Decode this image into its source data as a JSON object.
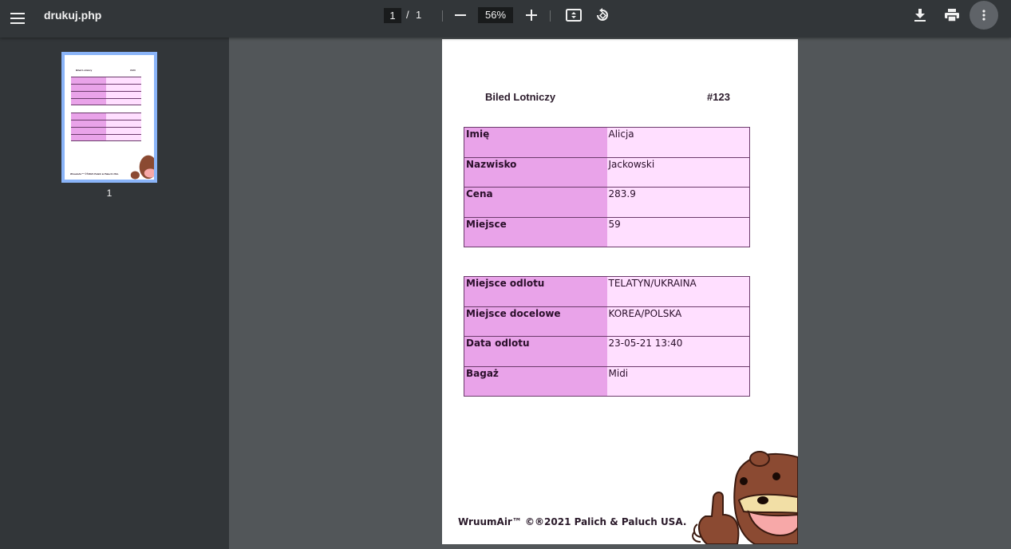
{
  "toolbar": {
    "doc_title": "drukuj.php",
    "current_page": "1",
    "page_sep": "/",
    "total_pages": "1",
    "zoom": "56%"
  },
  "sidebar": {
    "thumbnail_label": "1"
  },
  "ticket": {
    "title": "Biled Lotniczy",
    "number": "#123",
    "passenger_rows": [
      {
        "label": "Imię",
        "value": "Alicja"
      },
      {
        "label": "Nazwisko",
        "value": "Jackowski"
      },
      {
        "label": "Cena",
        "value": "283.9"
      },
      {
        "label": "Miejsce",
        "value": "59"
      }
    ],
    "flight_rows": [
      {
        "label": "Miejsce odlotu",
        "value": "TELATYN/UKRAINA"
      },
      {
        "label": "Miejsce docelowe",
        "value": "KOREA/POLSKA"
      },
      {
        "label": "Data odlotu",
        "value": "23-05-21 13:40"
      },
      {
        "label": "Bagaż",
        "value": "Midi"
      }
    ],
    "footer": "WruumAir™ ©®2021 Palich & Paluch USA."
  },
  "colors": {
    "toolbar_bg": "#323639",
    "viewer_bg": "#525659",
    "label_cell": "#e9a3e9",
    "value_cell": "#ffdfff",
    "thumb_border": "#8ab4f8"
  },
  "icons": [
    "menu-icon",
    "zoom-out-icon",
    "zoom-in-icon",
    "fit-page-icon",
    "rotate-icon",
    "download-icon",
    "print-icon",
    "more-vert-icon"
  ]
}
